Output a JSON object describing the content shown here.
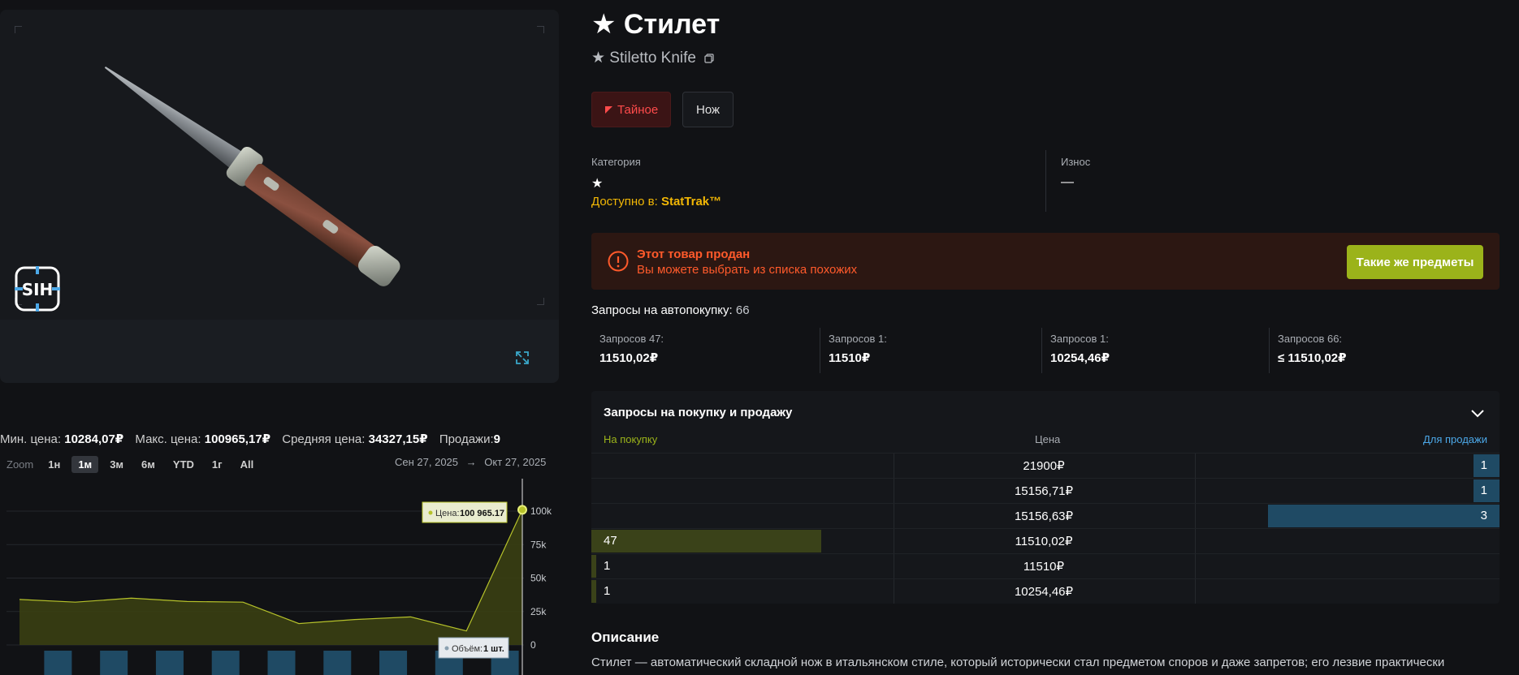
{
  "item": {
    "title": "★ Стилет",
    "subtitle": "★ Stiletto Knife",
    "rarity_tag": "Тайное",
    "type_tag": "Нож"
  },
  "info": {
    "category_label": "Категория",
    "category_value": "★",
    "available_prefix": "Доступно в:",
    "available_value": "StatTrak™",
    "wear_label": "Износ",
    "wear_value": "—"
  },
  "alert": {
    "title": "Этот товар продан",
    "text": "Вы можете выбрать из списка похожих",
    "button": "Такие же предметы"
  },
  "autobuy": {
    "label": "Запросы на автопокупку:",
    "count": "66",
    "boxes": [
      {
        "label": "Запросов 47:",
        "value": "11510,02₽"
      },
      {
        "label": "Запросов 1:",
        "value": "11510₽"
      },
      {
        "label": "Запросов 1:",
        "value": "10254,46₽"
      },
      {
        "label": "Запросов 66:",
        "value": "≤ 11510,02₽"
      }
    ]
  },
  "orders": {
    "title": "Запросы на покупку и продажу",
    "col_buy": "На покупку",
    "col_price": "Цена",
    "col_sell": "Для продажи",
    "rows": [
      {
        "buy": "",
        "price": "21900₽",
        "sell": "1",
        "sell_fraction": 0.085
      },
      {
        "buy": "",
        "price": "15156,71₽",
        "sell": "1",
        "sell_fraction": 0.085
      },
      {
        "buy": "",
        "price": "15156,63₽",
        "sell": "3",
        "sell_fraction": 0.76
      },
      {
        "buy": "47",
        "price": "11510,02₽",
        "sell": "",
        "buy_fraction": 0.76
      },
      {
        "buy": "1",
        "price": "11510₽",
        "sell": "",
        "buy_fraction": 0.016
      },
      {
        "buy": "1",
        "price": "10254,46₽",
        "sell": "",
        "buy_fraction": 0.016
      }
    ]
  },
  "description": {
    "title": "Описание",
    "text": "Стилет — автоматический складной нож в итальянском стиле, который исторически стал предметом споров и даже запретов; его лезвие практически"
  },
  "stats": {
    "min_label": "Мин. цена:",
    "min_value": "10284,07₽",
    "max_label": "Макс. цена:",
    "max_value": "100965,17₽",
    "avg_label": "Средняя цена:",
    "avg_value": "34327,15₽",
    "sales_label": "Продажи:",
    "sales_value": "9"
  },
  "zoom": {
    "label": "Zoom",
    "buttons": [
      "1н",
      "1м",
      "3м",
      "6м",
      "YTD",
      "1г",
      "All"
    ],
    "active": "1м",
    "date_from": "Сен 27, 2025",
    "date_sep": "→",
    "date_to": "Окт 27, 2025"
  },
  "chart_data": {
    "type": "area",
    "y_ticks": [
      "100k",
      "75k",
      "50k",
      "25k",
      "0"
    ],
    "ylim": [
      0,
      100000
    ],
    "price": [
      34000,
      32000,
      35000,
      32500,
      32000,
      16000,
      19000,
      21000,
      10500,
      100965
    ],
    "volume": [
      1,
      1,
      1,
      1,
      1,
      1,
      1,
      1,
      1,
      1
    ],
    "tooltip_price_label": "Цена:",
    "tooltip_price_value": "100 965.17",
    "tooltip_volume_label": "Объём:",
    "tooltip_volume_value": "1 шт.",
    "colors": {
      "line": "#b6c22a",
      "area": "#3a3f12",
      "volume": "#1f4a64"
    }
  }
}
